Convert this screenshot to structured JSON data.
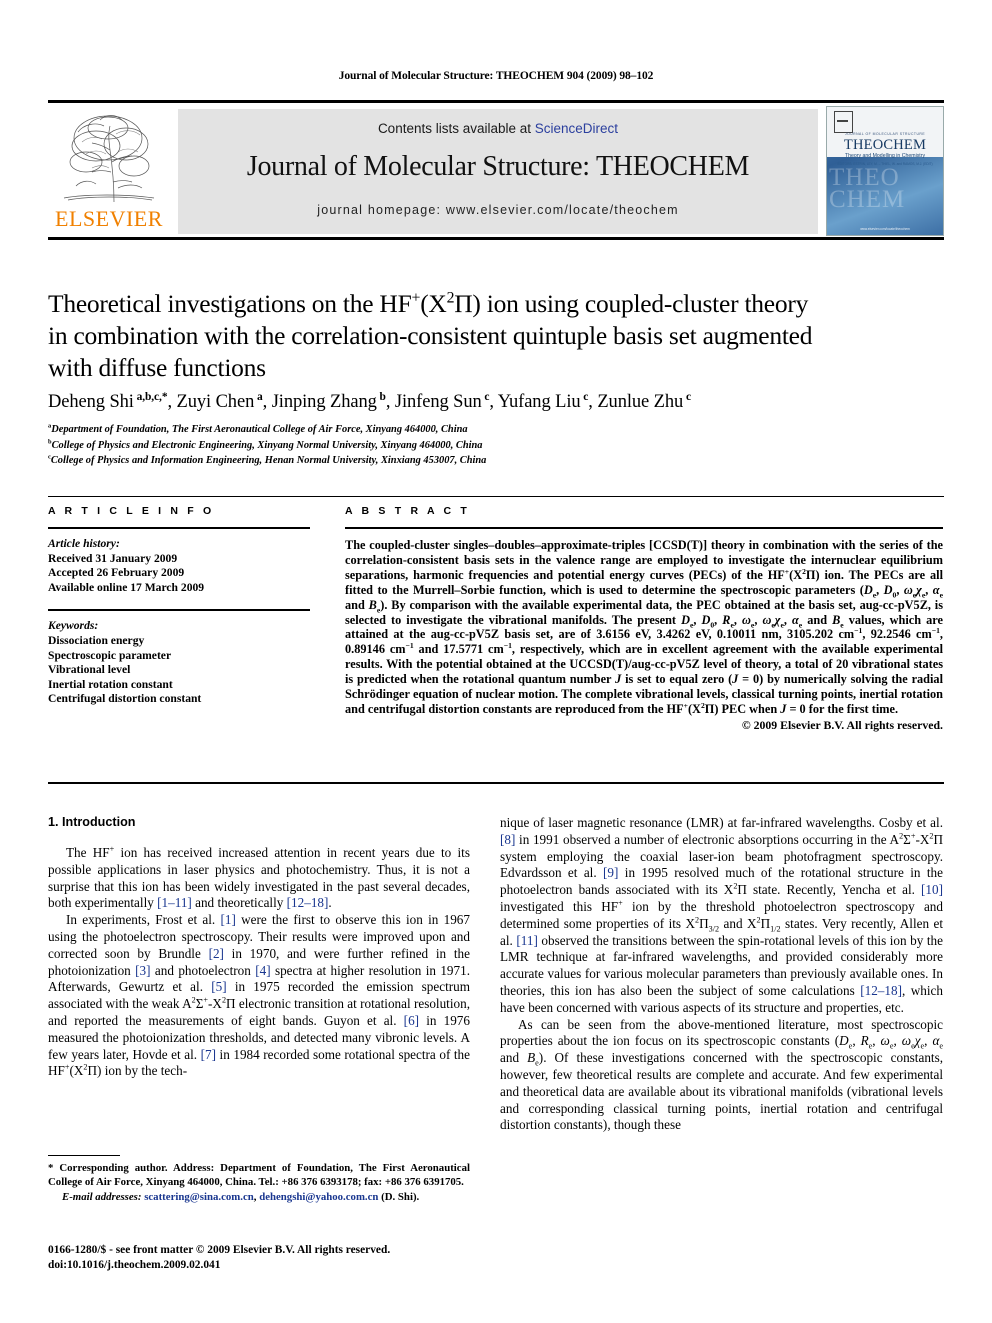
{
  "running_head": "Journal of Molecular Structure: THEOCHEM 904 (2009) 98–102",
  "masthead": {
    "contents_prefix": "Contents lists available at ",
    "sciencedirect": "ScienceDirect",
    "journal_title": "Journal of Molecular Structure: THEOCHEM",
    "homepage": "journal homepage: www.elsevier.com/locate/theochem",
    "publisher_name": "ELSEVIER",
    "cover": {
      "tiny_top": "JOURNAL OF MOLECULAR STRUCTURE",
      "brand": "THEOCHEM",
      "subtitle": "Theory and Modelling in Chemistry",
      "editors": "EDITORS: ESTRIN, LEY, M. – THIEL, W. and RAMOS, M.J. (EDIT)",
      "ghost": "THEO CHEM",
      "foot": "www.elsevier.com/locate/theochem"
    }
  },
  "article": {
    "title_line1": "Theoretical investigations on the HF",
    "title_sup1": "+",
    "title_x": "(X",
    "title_sup2": "2",
    "title_pi": "Π) ion using coupled-cluster theory",
    "title_line2": "in combination with the correlation-consistent quintuple basis set augmented",
    "title_line3": "with diffuse functions",
    "authors": "Deheng Shi a,b,c,*, Zuyi Chen a, Jinping Zhang b, Jinfeng Sun c, Yufang Liu c, Zunlue Zhu c",
    "affiliations": [
      {
        "marker": "a",
        "text": "Department of Foundation, The First Aeronautical College of Air Force, Xinyang 464000, China"
      },
      {
        "marker": "b",
        "text": "College of Physics and Electronic Engineering, Xinyang Normal University, Xinyang 464000, China"
      },
      {
        "marker": "c",
        "text": "College of Physics and Information Engineering, Henan Normal University, Xinxiang 453007, China"
      }
    ]
  },
  "article_info": {
    "heading": "A R T I C L E    I N F O",
    "history_label": "Article history:",
    "history": [
      "Received 31 January 2009",
      "Accepted 26 February 2009",
      "Available online 17 March 2009"
    ],
    "keywords_label": "Keywords:",
    "keywords": [
      "Dissociation energy",
      "Spectroscopic parameter",
      "Vibrational level",
      "Inertial rotation constant",
      "Centrifugal distortion constant"
    ]
  },
  "abstract": {
    "heading": "A B S T R A C T",
    "copyright": "© 2009 Elsevier B.V. All rights reserved."
  },
  "introduction": {
    "heading": "1. Introduction",
    "left_paragraphs": [
      "The HF+ ion has received increased attention in recent years due to its possible applications in laser physics and photochemistry. Thus, it is not a surprise that this ion has been widely investigated in the past several decades, both experimentally [1–11] and theoretically [12–18].",
      "In experiments, Frost et al. [1] were the first to observe this ion in 1967 using the photoelectron spectroscopy. Their results were improved upon and corrected soon by Brundle [2] in 1970, and were further refined in the photoionization [3] and photoelectron [4] spectra at higher resolution in 1971. Afterwards, Gewurtz et al. [5] in 1975 recorded the emission spectrum associated with the weak A2Σ+-X2Π electronic transition at rotational resolution, and reported the measurements of eight bands. Guyon et al. [6] in 1976 measured the photoionization thresholds, and detected many vibronic levels. A few years later, Hovde et al. [7] in 1984 recorded some rotational spectra of the HF+(X2Π) ion by the technique"
    ]
  },
  "footnote": {
    "corresponding": "* Corresponding author. Address: Department of Foundation, The First Aeronautical College of Air Force, Xinyang 464000, China. Tel.: +86 376 6393178; fax: +86 376 6391705.",
    "email_label": "E-mail addresses:",
    "email1": "scattering@sina.com.cn",
    "email2": "dehengshi@yahoo.com.cn",
    "email_suffix": "(D. Shi)."
  },
  "imprint": {
    "line1": "0166-1280/$ - see front matter © 2009 Elsevier B.V. All rights reserved.",
    "line2": "doi:10.1016/j.theochem.2009.02.041"
  },
  "colors": {
    "link": "#19368f",
    "sciencedirect": "#2b3f9e",
    "elsevier_orange": "#F08000",
    "band": "#e3e3e3"
  }
}
